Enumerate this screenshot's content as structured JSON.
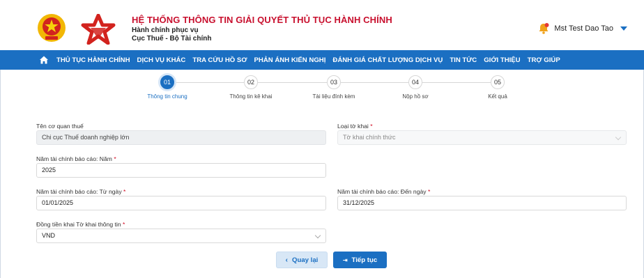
{
  "header": {
    "title": "HỆ THỐNG THÔNG TIN GIẢI QUYẾT THỦ TỤC HÀNH CHÍNH",
    "subtitle1": "Hành chính phục vụ",
    "subtitle2": "Cục Thuế - Bộ Tài chính",
    "user_name": "Mst Test Dao Tao"
  },
  "nav": {
    "items": [
      "THỦ TỤC HÀNH CHÍNH",
      "DỊCH VỤ KHÁC",
      "TRA CỨU HỒ SƠ",
      "PHẢN ÁNH KIẾN NGHỊ",
      "ĐÁNH GIÁ CHẤT LƯỢNG DỊCH VỤ",
      "TIN TỨC",
      "GIỚI THIỆU",
      "TRỢ GIÚP"
    ]
  },
  "stepper": {
    "steps": [
      {
        "num": "01",
        "label": "Thông tin chung"
      },
      {
        "num": "02",
        "label": "Thông tin kê khai"
      },
      {
        "num": "03",
        "label": "Tài liệu đính kèm"
      },
      {
        "num": "04",
        "label": "Nộp hồ sơ"
      },
      {
        "num": "05",
        "label": "Kết quả"
      }
    ],
    "active_index": 0
  },
  "form": {
    "tax_agency": {
      "label": "Tên cơ quan thuế",
      "value": "Chi cục Thuế doanh nghiệp lớn"
    },
    "declaration_type": {
      "label": "Loại tờ khai",
      "required": "*",
      "value": "Tờ khai chính thức"
    },
    "fiscal_year": {
      "label": "Năm tài chính báo cáo: Năm",
      "required": "*",
      "value": "2025"
    },
    "from_date": {
      "label": "Năm tài chính báo cáo: Từ ngày",
      "required": "*",
      "value": "01/01/2025"
    },
    "to_date": {
      "label": "Năm tài chính báo cáo: Đến ngày",
      "required": "*",
      "value": "31/12/2025"
    },
    "currency": {
      "label": "Đồng tiền khai Tờ khai thông tin",
      "required": "*",
      "value": "VND"
    }
  },
  "buttons": {
    "back": "Quay lại",
    "next": "Tiếp tục"
  },
  "colors": {
    "primary": "#1b6fc2",
    "title_red": "#c8102e",
    "required": "#d0021b"
  }
}
